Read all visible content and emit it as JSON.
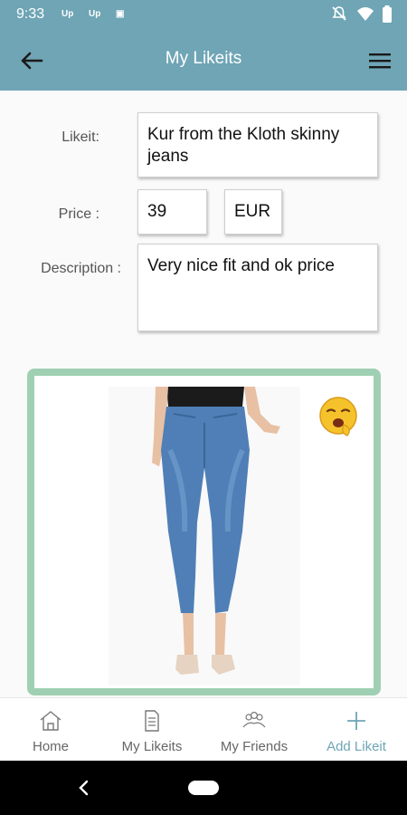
{
  "status_bar": {
    "time": "9:33",
    "notifications": [
      "Up",
      "Up",
      "▣"
    ]
  },
  "app_bar": {
    "title": "My Likeits",
    "back_icon": "arrow-left-icon",
    "menu_icon": "hamburger-icon"
  },
  "form": {
    "likeit_label": "Likeit:",
    "likeit_value": "Kur from the Kloth skinny jeans",
    "price_label": "Price :",
    "price_value": "39",
    "currency_value": "EUR",
    "description_label": "Description :",
    "description_value": "Very nice fit and ok price"
  },
  "photo": {
    "frame_color": "#9fd0b3",
    "reaction_icon": "yawning-face-emoji-icon"
  },
  "bottom_nav": {
    "items": [
      {
        "label": "Home",
        "icon": "home-icon"
      },
      {
        "label": "My Likeits",
        "icon": "document-icon"
      },
      {
        "label": "My Friends",
        "icon": "people-icon"
      },
      {
        "label": "Add Likeit",
        "icon": "plus-icon"
      }
    ],
    "active_index": 3
  },
  "colors": {
    "primary": "#6fa5b5",
    "accent_green": "#9fd0b3"
  }
}
